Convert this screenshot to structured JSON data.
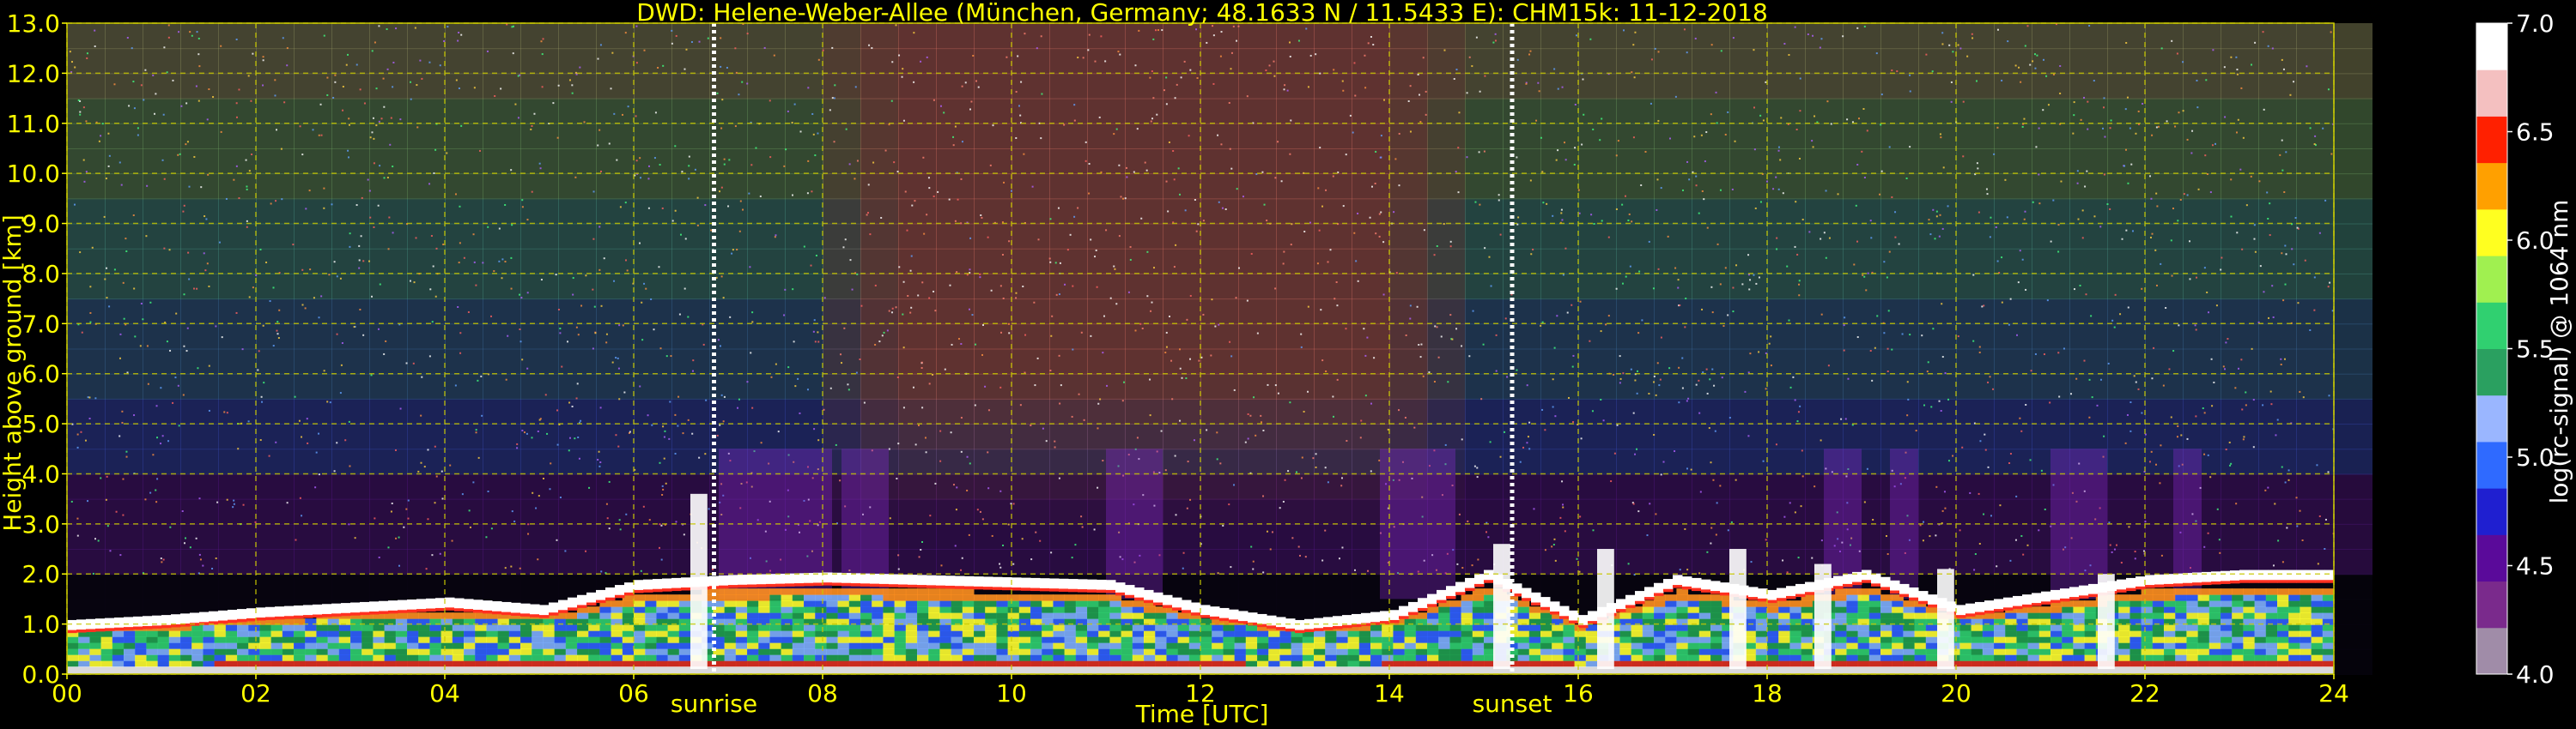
{
  "chart_data": {
    "type": "heatmap",
    "title": "DWD: Helene-Weber-Allee (München, Germany; 48.1633 N / 11.5433 E):    CHM15k: 11-12-2018",
    "xlabel": "Time [UTC]",
    "ylabel": "Height above ground [km]",
    "colorbar_label": "log(rc-signal) @ 1064 nm",
    "xlim": [
      0,
      24
    ],
    "ylim": [
      0,
      13
    ],
    "clim": [
      4.0,
      7.0
    ],
    "x_ticks": [
      "00",
      "02",
      "04",
      "06",
      "08",
      "10",
      "12",
      "14",
      "16",
      "18",
      "20",
      "22",
      "24"
    ],
    "y_ticks": [
      "0.0",
      "1.0",
      "2.0",
      "3.0",
      "4.0",
      "5.0",
      "6.0",
      "7.0",
      "8.0",
      "9.0",
      "10.0",
      "11.0",
      "12.0",
      "13.0"
    ],
    "colorbar_ticks": [
      "4.0",
      "4.5",
      "5.0",
      "5.5",
      "6.0",
      "6.5",
      "7.0"
    ],
    "grid": true,
    "markers": [
      {
        "label": "sunrise",
        "time": 6.85
      },
      {
        "label": "sunset",
        "time": 15.3
      }
    ],
    "cloud_base_height_km": [
      [
        0,
        1.0
      ],
      [
        1,
        1.1
      ],
      [
        2,
        1.25
      ],
      [
        3,
        1.35
      ],
      [
        4,
        1.45
      ],
      [
        5,
        1.3
      ],
      [
        6,
        1.8
      ],
      [
        7,
        1.9
      ],
      [
        8,
        1.95
      ],
      [
        9,
        1.9
      ],
      [
        10,
        1.85
      ],
      [
        11,
        1.8
      ],
      [
        12,
        1.3
      ],
      [
        13,
        1.0
      ],
      [
        14,
        1.2
      ],
      [
        15,
        2.0
      ],
      [
        16,
        1.1
      ],
      [
        17,
        1.9
      ],
      [
        18,
        1.6
      ],
      [
        19,
        2.0
      ],
      [
        20,
        1.3
      ],
      [
        21,
        1.6
      ],
      [
        22,
        1.9
      ],
      [
        23,
        2.0
      ],
      [
        24,
        2.0
      ]
    ],
    "colors": {
      "text": "#ffff00",
      "grid": "#c8c800",
      "background": "#000000",
      "colorbar_stops": [
        "#a08ca8",
        "#7a2a8c",
        "#5a0a9a",
        "#1f1fd0",
        "#2f6aff",
        "#9ab6ff",
        "#2aa060",
        "#30d070",
        "#a0f050",
        "#ffff20",
        "#ffa000",
        "#ff2000",
        "#f4c0c0",
        "#ffffff"
      ]
    }
  }
}
